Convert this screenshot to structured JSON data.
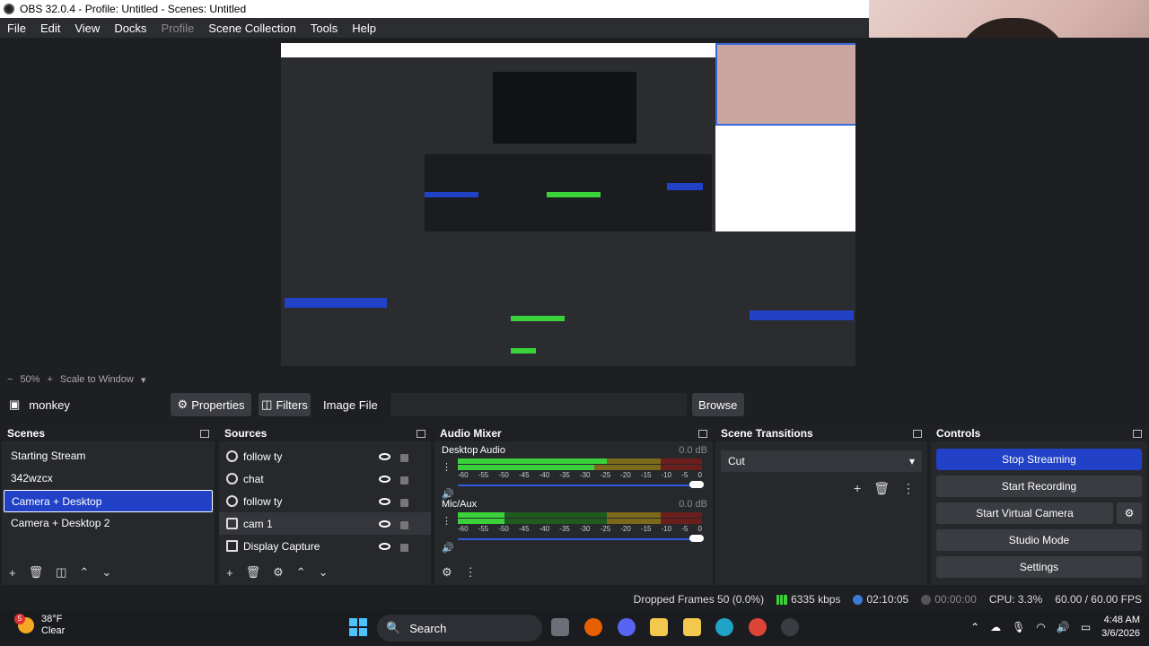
{
  "window": {
    "title": "OBS 32.0.4 - Profile: Untitled - Scenes: Untitled"
  },
  "menu": [
    "File",
    "Edit",
    "View",
    "Docks",
    "Profile",
    "Scene Collection",
    "Tools",
    "Help"
  ],
  "zoom": {
    "minus": "−",
    "value": "50%",
    "plus": "+",
    "mode": "Scale to Window"
  },
  "source_toolbar": {
    "name": "monkey",
    "properties": "Properties",
    "filters": "Filters",
    "type": "Image File",
    "browse": "Browse"
  },
  "scenes": {
    "title": "Scenes",
    "items": [
      "Starting Stream",
      "342wzcx",
      "Camera + Desktop",
      "Camera + Desktop 2"
    ],
    "selected": "Camera + Desktop"
  },
  "sources": {
    "title": "Sources",
    "items": [
      {
        "label": "follow ty",
        "icon": "globe-icon"
      },
      {
        "label": "chat",
        "icon": "globe-icon"
      },
      {
        "label": "follow ty",
        "icon": "globe-icon"
      },
      {
        "label": "cam 1",
        "icon": "camera-icon"
      },
      {
        "label": "Display Capture",
        "icon": "monitor-icon"
      }
    ]
  },
  "mixer": {
    "title": "Audio Mixer",
    "channels": [
      {
        "name": "Desktop Audio",
        "db": "0.0 dB",
        "level": 0.6
      },
      {
        "name": "Mic/Aux",
        "db": "0.0 dB",
        "level": 0.2
      }
    ],
    "scale": [
      "-60",
      "-55",
      "-50",
      "-45",
      "-40",
      "-35",
      "-30",
      "-25",
      "-20",
      "-15",
      "-10",
      "-5",
      "0"
    ]
  },
  "transitions": {
    "title": "Scene Transitions",
    "selected": "Cut"
  },
  "controls": {
    "title": "Controls",
    "stop_streaming": "Stop Streaming",
    "start_recording": "Start Recording",
    "start_virtual_camera": "Start Virtual Camera",
    "studio_mode": "Studio Mode",
    "settings": "Settings"
  },
  "status": {
    "dropped": "Dropped Frames 50 (0.0%)",
    "bitrate": "6335 kbps",
    "stream_time": "02:10:05",
    "rec_time": "00:00:00",
    "cpu": "CPU: 3.3%",
    "fps": "60.00 / 60.00 FPS"
  },
  "taskbar": {
    "temp": "38°F",
    "condition": "Clear",
    "weather_badge": "5",
    "search": "Search",
    "time": "4:48 AM",
    "date": "3/6/2026"
  },
  "colors": {
    "accent": "#2141c6",
    "meter_green": "#3ad13a",
    "meter_yellow": "#c8a82a",
    "meter_red": "#c8302a"
  }
}
